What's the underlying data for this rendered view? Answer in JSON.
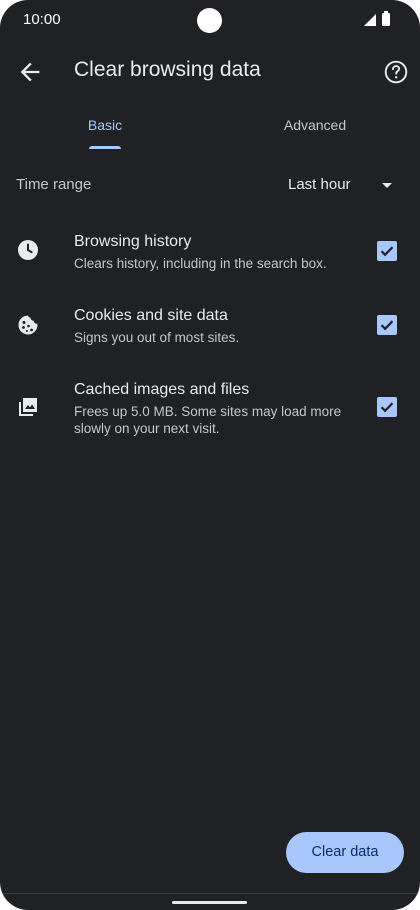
{
  "status_bar": {
    "time": "10:00"
  },
  "toolbar": {
    "title": "Clear browsing data",
    "back_icon": "arrow-back-icon",
    "help_icon": "help-circle-icon"
  },
  "tabs": [
    {
      "label": "Basic",
      "selected": true
    },
    {
      "label": "Advanced",
      "selected": false
    }
  ],
  "time_range": {
    "label": "Time range",
    "value": "Last hour"
  },
  "items": [
    {
      "title": "Browsing history",
      "subtitle": "Clears history, including in the search box.",
      "icon": "clock-icon",
      "checked": true
    },
    {
      "title": "Cookies and site data",
      "subtitle": "Signs you out of most sites.",
      "icon": "cookie-icon",
      "checked": true
    },
    {
      "title": "Cached images and files",
      "subtitle": "Frees up 5.0 MB. Some sites may load more slowly on your next visit.",
      "icon": "image-icon",
      "checked": true
    }
  ],
  "footer": {
    "clear_label": "Clear data"
  },
  "colors": {
    "background": "#202124",
    "accent": "#a8c7fa",
    "text_primary": "#e8eaed",
    "text_secondary": "#c4c7c5"
  }
}
